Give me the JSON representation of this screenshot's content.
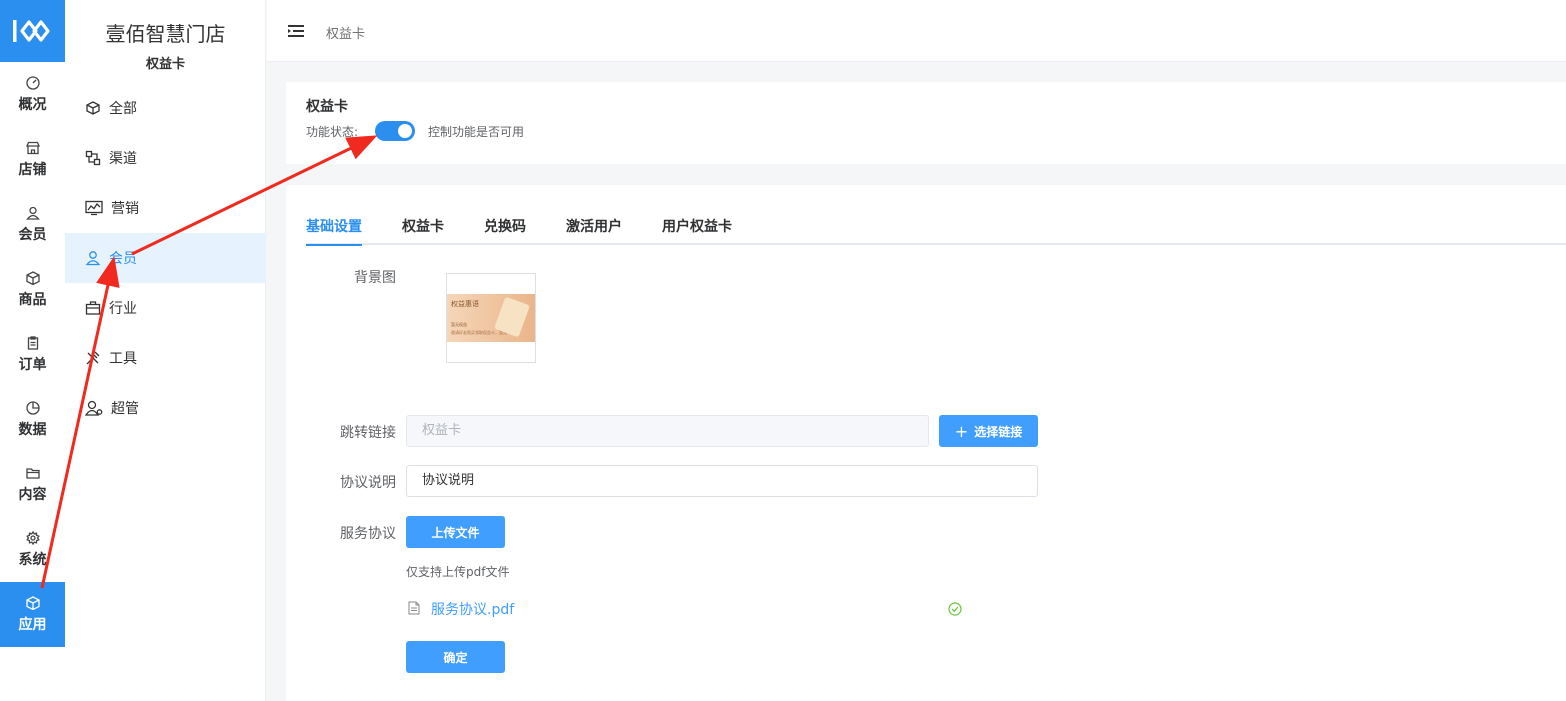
{
  "colors": {
    "accent": "#2b8ff0",
    "button": "#409eff",
    "annotation": "#f02a1e",
    "success": "#67c23a"
  },
  "rail": {
    "items": [
      {
        "label": "概况",
        "icon": "dashboard-icon"
      },
      {
        "label": "店铺",
        "icon": "store-icon"
      },
      {
        "label": "会员",
        "icon": "user-icon"
      },
      {
        "label": "商品",
        "icon": "box-icon"
      },
      {
        "label": "订单",
        "icon": "clipboard-icon"
      },
      {
        "label": "数据",
        "icon": "pie-chart-icon"
      },
      {
        "label": "内容",
        "icon": "folder-icon"
      },
      {
        "label": "系统",
        "icon": "gear-icon"
      },
      {
        "label": "应用",
        "icon": "box-icon",
        "active": true
      }
    ]
  },
  "sidebar": {
    "title": "壹佰智慧门店",
    "subtitle": "权益卡",
    "items": [
      {
        "label": "全部",
        "icon": "box-icon"
      },
      {
        "label": "渠道",
        "icon": "channel-icon"
      },
      {
        "label": "营销",
        "icon": "trend-chart-icon"
      },
      {
        "label": "会员",
        "icon": "user-icon",
        "active": true
      },
      {
        "label": "行业",
        "icon": "briefcase-icon"
      },
      {
        "label": "工具",
        "icon": "tools-icon"
      },
      {
        "label": "超管",
        "icon": "admin-user-icon"
      }
    ]
  },
  "header": {
    "breadcrumb": "权益卡",
    "menu_icon": "menu-toggle-icon"
  },
  "status_panel": {
    "title": "权益卡",
    "status_label": "功能状态:",
    "enabled": true,
    "description": "控制功能是否可用"
  },
  "tabs": [
    {
      "label": "基础设置",
      "active": true
    },
    {
      "label": "权益卡"
    },
    {
      "label": "兑换码"
    },
    {
      "label": "激活用户"
    },
    {
      "label": "用户权益卡"
    }
  ],
  "form": {
    "background_label": "背景图",
    "background_card": {
      "title": "权益惠语",
      "line1": "暂无权益",
      "line2": "邀请好友购买领取权益卡，暂无"
    },
    "link_label": "跳转链接",
    "link_placeholder": "权益卡",
    "select_link_button": "选择链接",
    "agreement_label": "协议说明",
    "agreement_value": "协议说明",
    "service_label": "服务协议",
    "upload_button": "上传文件",
    "upload_tip": "仅支持上传pdf文件",
    "file_name": "服务协议.pdf",
    "confirm_button": "确定"
  }
}
